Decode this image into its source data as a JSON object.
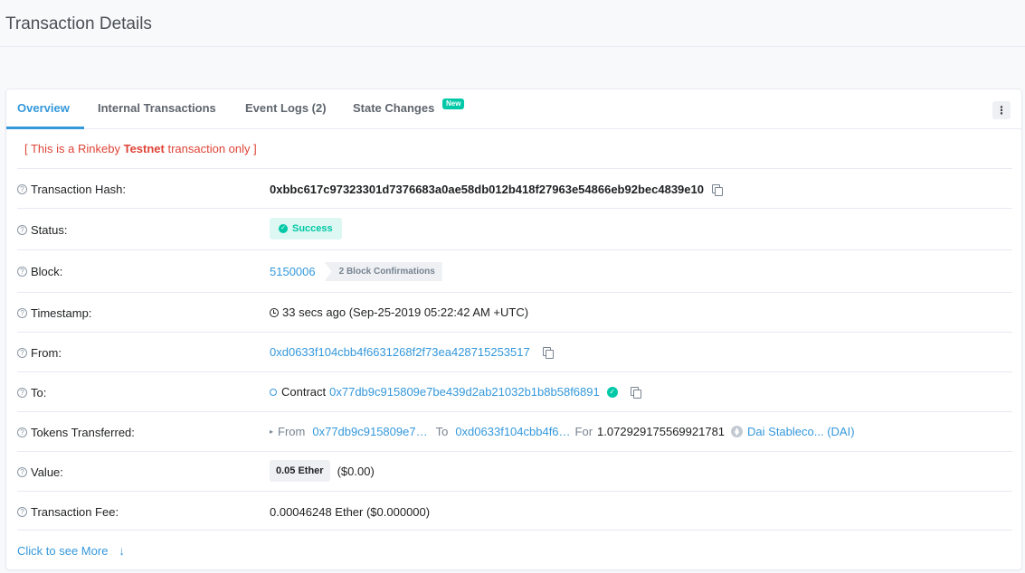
{
  "page": {
    "title": "Transaction Details"
  },
  "tabs": [
    {
      "label": "Overview"
    },
    {
      "label": "Internal Transactions"
    },
    {
      "label": "Event Logs (2)"
    },
    {
      "label": "State Changes"
    }
  ],
  "new_badge": "New",
  "more_menu": "⋮",
  "notice": {
    "prefix": "[ This is a Rinkeby ",
    "bold": "Testnet",
    "suffix": " transaction only ]"
  },
  "rows": {
    "hash": {
      "label": "Transaction Hash:",
      "value": "0xbbc617c97323301d7376683a0ae58db012b418f27963e54866eb92bec4839e10"
    },
    "status": {
      "label": "Status:",
      "value": "Success"
    },
    "block": {
      "label": "Block:",
      "value": "5150006",
      "confirmations": "2 Block Confirmations"
    },
    "timestamp": {
      "label": "Timestamp:",
      "value": "33 secs ago (Sep-25-2019 05:22:42 AM +UTC)"
    },
    "from": {
      "label": "From:",
      "value": "0xd0633f104cbb4f6631268f2f73ea428715253517"
    },
    "to": {
      "label": "To:",
      "prefix": "Contract",
      "value": "0x77db9c915809e7be439d2ab21032b1b8b58f6891"
    },
    "tokens": {
      "label": "Tokens Transferred:",
      "from_label": "From",
      "from_value": "0x77db9c915809e7…",
      "to_label": "To",
      "to_value": "0xd0633f104cbb4f6…",
      "for_label": "For",
      "amount": "1.072929175569921781",
      "token": "Dai Stableco... (DAI)"
    },
    "value": {
      "label": "Value:",
      "badge": "0.05 Ether",
      "usd": "($0.00)"
    },
    "fee": {
      "label": "Transaction Fee:",
      "value": "0.00046248 Ether ($0.000000)"
    }
  },
  "see_more": {
    "label": "Click to see More",
    "arrow": "↓"
  },
  "colors": {
    "accent": "#3498db",
    "success": "#00c9a7",
    "danger": "#de4437"
  }
}
